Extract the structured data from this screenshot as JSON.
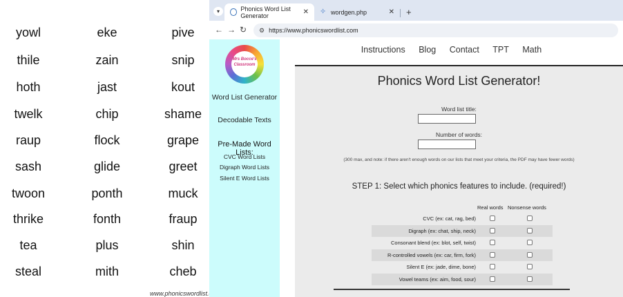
{
  "pdf": {
    "columns": [
      [
        "yowl",
        "thile",
        "hoth",
        "twelk",
        "raup",
        "sash",
        "twoon",
        "thrike",
        "tea",
        "steal"
      ],
      [
        "eke",
        "zain",
        "jast",
        "chip",
        "flock",
        "glide",
        "ponth",
        "fonth",
        "plus",
        "mith"
      ],
      [
        "pive",
        "snip",
        "kout",
        "shame",
        "grape",
        "greet",
        "muck",
        "fraup",
        "shin",
        "cheb"
      ]
    ],
    "footer": "www.phonicswordlist.o"
  },
  "browser": {
    "tabs": [
      {
        "title": "Phonics Word List Generator",
        "close": "✕"
      },
      {
        "title": "wordgen.php",
        "close": "✕"
      }
    ],
    "new_tab": "+",
    "url": "https://www.phonicswordlist.com"
  },
  "sidebar": {
    "logo_text": "Mrs Bocce's Classroom",
    "links": [
      "Word List Generator",
      "Decodable Texts"
    ],
    "premade_heading": "Pre-Made Word Lists:",
    "premade_links": [
      "CVC Word Lists",
      "Digraph Word Lists",
      "Silent E Word Lists"
    ]
  },
  "topnav": [
    "Instructions",
    "Blog",
    "Contact",
    "TPT",
    "Math"
  ],
  "generator": {
    "title": "Phonics Word List Generator!",
    "title_label": "Word list title:",
    "count_label": "Number of words:",
    "note": "(300 max, and note: if there aren't enough words on our lists that meet your criteria, the PDF may have fewer words)",
    "step1": "STEP 1: Select which phonics features to include. (required!)",
    "col_real": "Real words",
    "col_nonsense": "Nonsense words",
    "features": [
      "CVC (ex: cat, rag, bed)",
      "Digraph (ex: chat, ship, neck)",
      "Consonant blend (ex: blot, self, twist)",
      "R-controlled vowels (ex: car, firm, fork)",
      "Silent E (ex: jade, dime, bone)",
      "Vowel teams (ex: aim, food, sour)"
    ]
  }
}
